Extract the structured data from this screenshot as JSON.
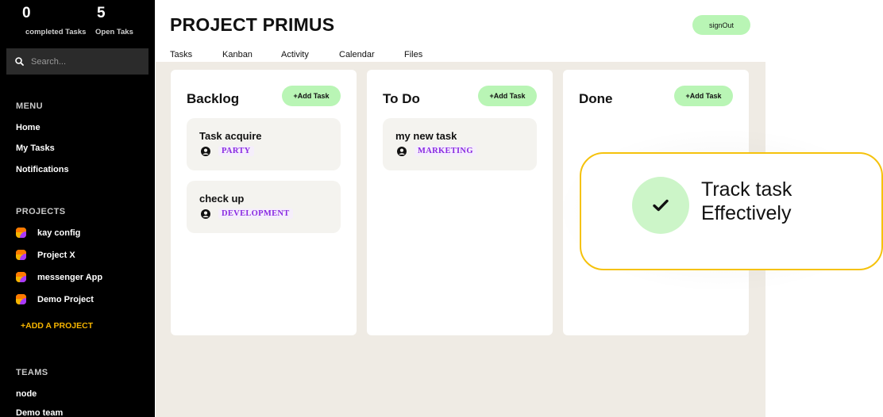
{
  "stats": {
    "completed_count": "0",
    "completed_label": "completed Tasks",
    "open_count": "5",
    "open_label": "Open Taks"
  },
  "search": {
    "placeholder": "Search..."
  },
  "menu": {
    "title": "MENU",
    "items": [
      "Home",
      "My Tasks",
      "Notifications"
    ]
  },
  "projects": {
    "title": "PROJECTS",
    "items": [
      "kay config",
      "Project X",
      "messenger App",
      "Demo Project"
    ],
    "add_label": "+ADD A PROJECT"
  },
  "teams": {
    "title": "TEAMS",
    "items": [
      "node",
      "Demo team"
    ]
  },
  "header": {
    "title": "PROJECT PRIMUS",
    "signout_label": "signOut",
    "tabs": [
      "Tasks",
      "Kanban",
      "Activity",
      "Calendar",
      "Files"
    ]
  },
  "board": {
    "columns": [
      {
        "title": "Backlog",
        "add_label": "+Add Task",
        "cards": [
          {
            "title": "Task acquire",
            "tag": "PARTY"
          },
          {
            "title": "check up",
            "tag": "DEVELOPMENT"
          }
        ]
      },
      {
        "title": "To Do",
        "add_label": "+Add Task",
        "cards": [
          {
            "title": "my new task",
            "tag": "MARKETING"
          }
        ]
      },
      {
        "title": "Done",
        "add_label": "+Add Task",
        "cards": []
      }
    ]
  },
  "callout": {
    "line1": "Track task",
    "line2": "Effectively"
  },
  "colors": {
    "accent_green": "#b9f5b5",
    "accent_yellow": "#f5b400",
    "tag_purple": "#8a2be2",
    "sidebar_bg": "#000000",
    "board_bg": "#efebe4"
  }
}
